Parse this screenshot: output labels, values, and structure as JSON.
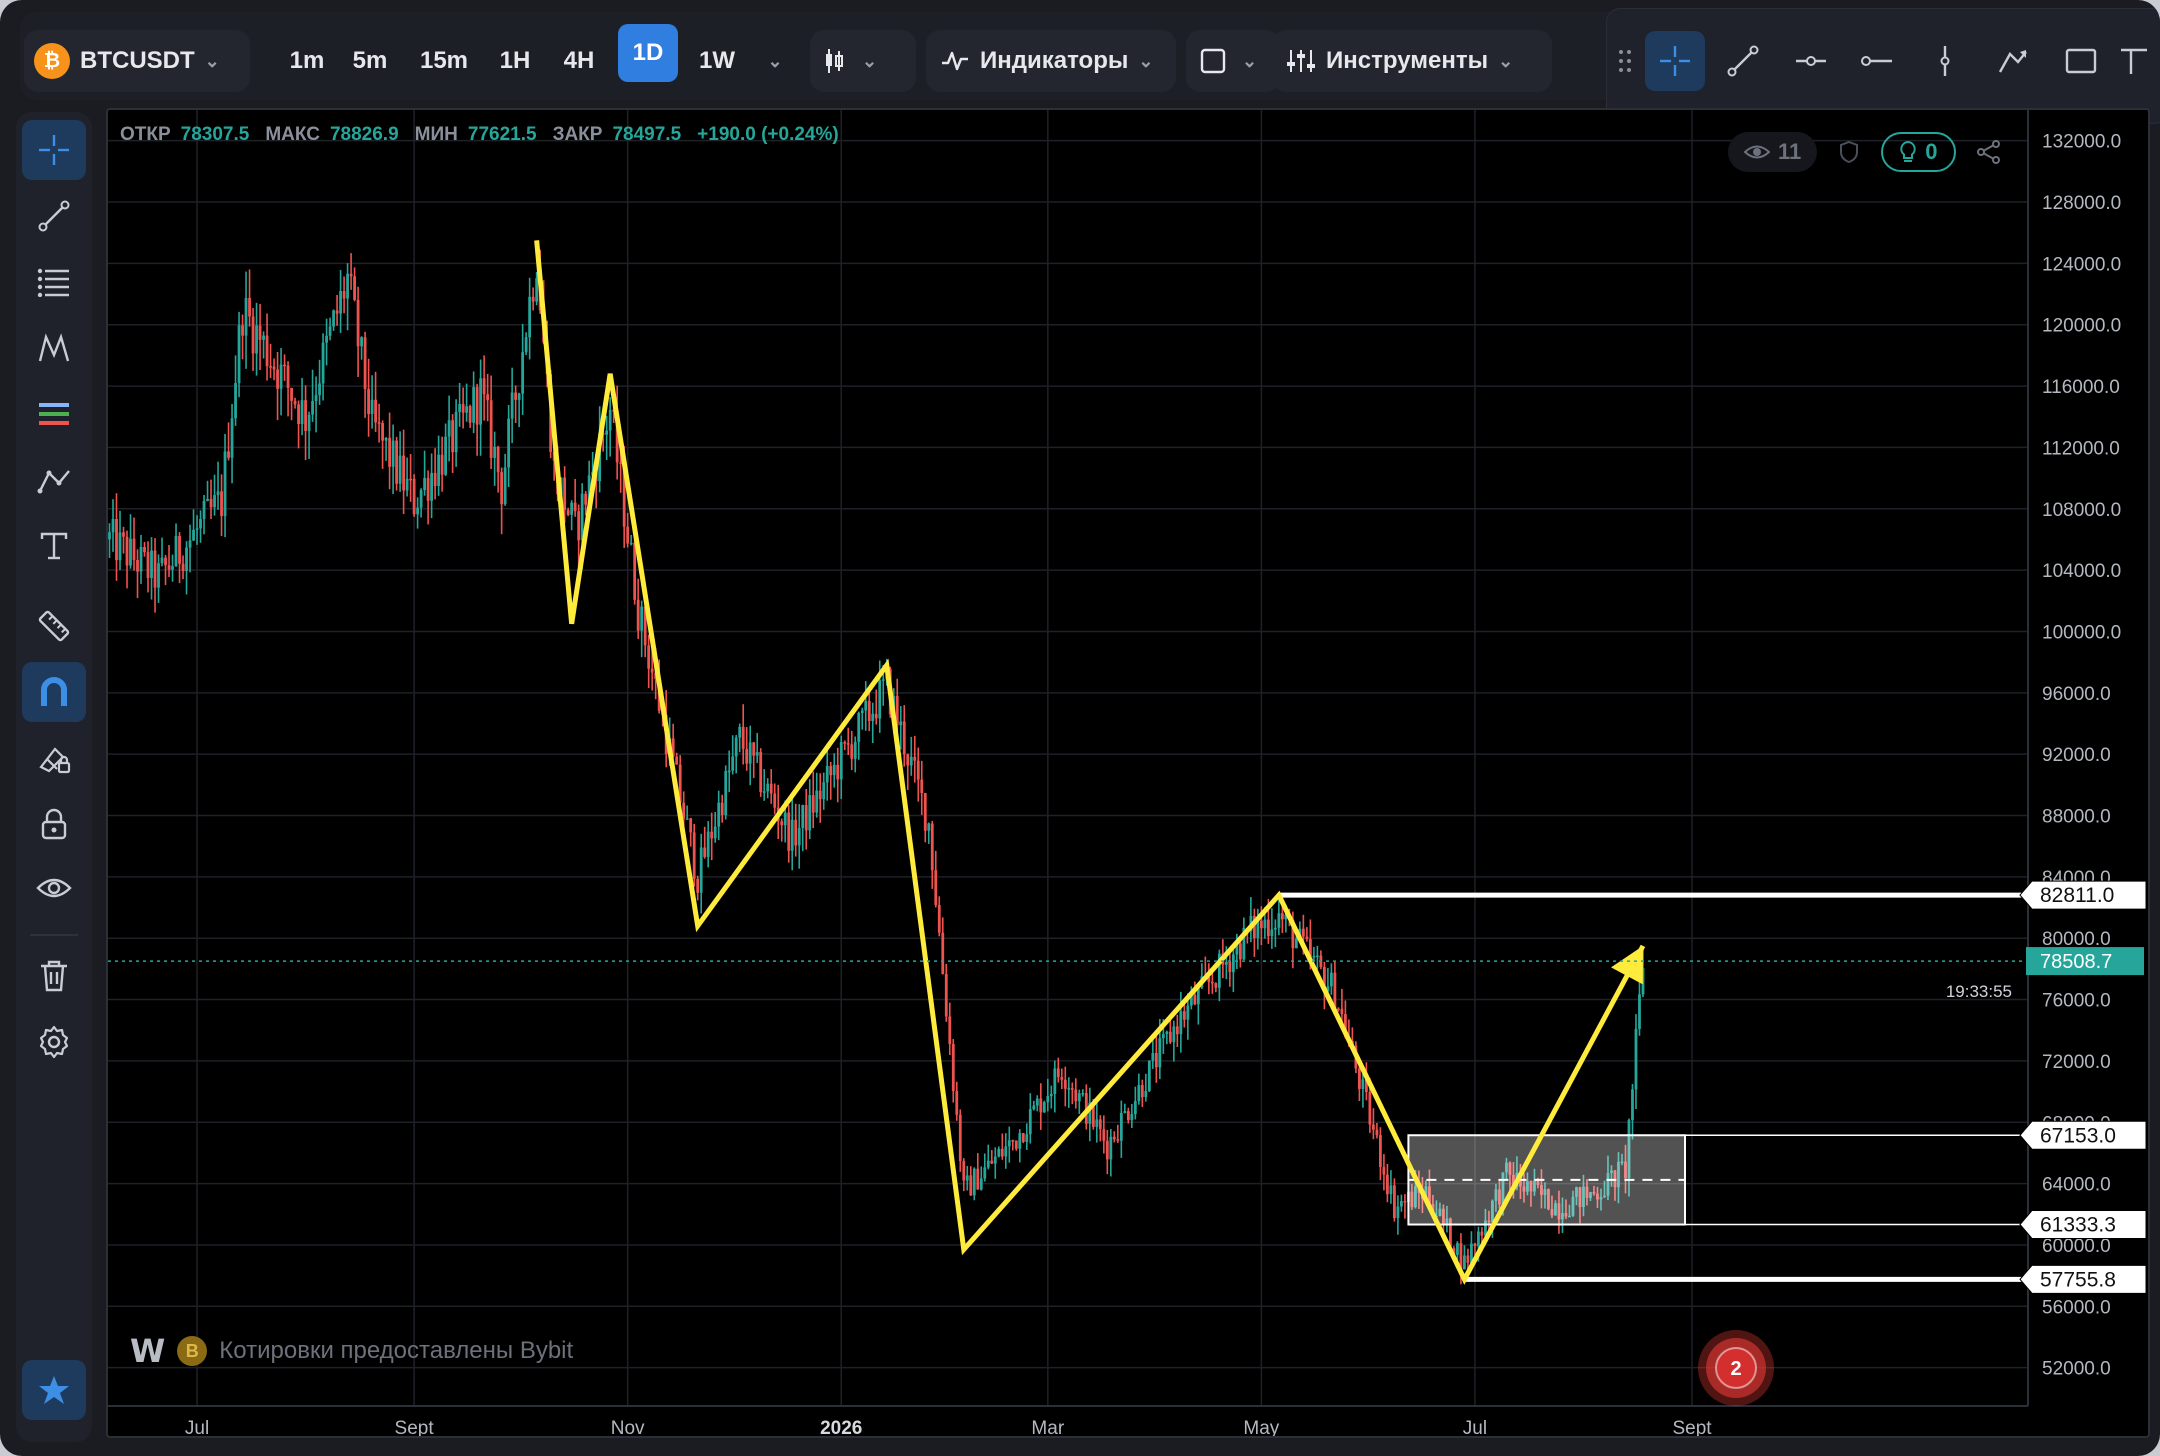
{
  "toolbar": {
    "symbol": "BTCUSDT",
    "coin_glyph": "₿",
    "timeframes": [
      "1m",
      "5m",
      "15m",
      "1H",
      "4H",
      "1D",
      "1W"
    ],
    "active_timeframe": "1D",
    "indicators_label": "Индикаторы",
    "tools_label": "Инструменты"
  },
  "ohlc": {
    "open_label": "ОТКР",
    "open": "78307.5",
    "high_label": "МАКС",
    "high": "78826.9",
    "low_label": "МИН",
    "low": "77621.5",
    "close_label": "ЗАКР",
    "close": "78497.5",
    "change": "+190.0 (+0.24%)"
  },
  "badges": {
    "views": "11",
    "ideas": "0"
  },
  "attribution": {
    "logo": "W",
    "coin_glyph": "B",
    "text": "Котировки предоставлены Bybit"
  },
  "alert_count": "2",
  "colors": {
    "up": "#26a69a",
    "down": "#ef5350",
    "drawing": "#ffeb3b",
    "accent": "#2f7ee0",
    "price_label": "#26a69a"
  },
  "left_tools": [
    "crosshair-icon",
    "trendline-icon",
    "fib-icon",
    "pattern-icon",
    "gann-icon",
    "path-icon",
    "text-icon",
    "ruler-icon",
    "magnet-icon",
    "brush-lock-icon",
    "lock-icon",
    "eye-icon",
    "trash-icon",
    "settings-icon",
    "star-icon"
  ],
  "chart_data": {
    "type": "candlestick",
    "timeframe": "1D",
    "x_tick_labels": [
      "Jul",
      "Sept",
      "Nov",
      "2026",
      "Mar",
      "May",
      "Jul",
      "Sept"
    ],
    "y_tick_labels": [
      "132000.0",
      "128000.0",
      "124000.0",
      "120000.0",
      "116000.0",
      "112000.0",
      "108000.0",
      "104000.0",
      "100000.0",
      "96000.0",
      "92000.0",
      "88000.0",
      "84000.0",
      "80000.0",
      "76000.0",
      "72000.0",
      "68000.0",
      "64000.0",
      "60000.0",
      "56000.0",
      "52000.0"
    ],
    "ylim": [
      49500,
      134000
    ],
    "last_price": "78508.7",
    "countdown": "19:33:55",
    "anchors": [
      {
        "date": "2025-06-06",
        "price": 106000
      },
      {
        "date": "2025-06-20",
        "price": 103500
      },
      {
        "date": "2025-07-08",
        "price": 108500
      },
      {
        "date": "2025-07-14",
        "price": 121000
      },
      {
        "date": "2025-08-01",
        "price": 114000
      },
      {
        "date": "2025-08-13",
        "price": 123000
      },
      {
        "date": "2025-08-20",
        "price": 113500
      },
      {
        "date": "2025-09-01",
        "price": 108500
      },
      {
        "date": "2025-09-20",
        "price": 115500
      },
      {
        "date": "2025-09-26",
        "price": 109500
      },
      {
        "date": "2025-10-06",
        "price": 124500
      },
      {
        "date": "2025-10-11",
        "price": 110500
      },
      {
        "date": "2025-10-17",
        "price": 106500
      },
      {
        "date": "2025-10-27",
        "price": 114500
      },
      {
        "date": "2025-11-04",
        "price": 101500
      },
      {
        "date": "2025-11-21",
        "price": 84000
      },
      {
        "date": "2025-12-03",
        "price": 93000
      },
      {
        "date": "2025-12-18",
        "price": 86500
      },
      {
        "date": "2026-01-14",
        "price": 96500
      },
      {
        "date": "2026-01-26",
        "price": 87500
      },
      {
        "date": "2026-02-05",
        "price": 63500
      },
      {
        "date": "2026-02-20",
        "price": 67000
      },
      {
        "date": "2026-03-05",
        "price": 71500
      },
      {
        "date": "2026-03-18",
        "price": 66500
      },
      {
        "date": "2026-04-07",
        "price": 74500
      },
      {
        "date": "2026-04-28",
        "price": 80500
      },
      {
        "date": "2026-05-06",
        "price": 81500
      },
      {
        "date": "2026-05-22",
        "price": 76500
      },
      {
        "date": "2026-06-08",
        "price": 62500
      },
      {
        "date": "2026-06-17",
        "price": 63500
      },
      {
        "date": "2026-06-28",
        "price": 58800
      },
      {
        "date": "2026-07-10",
        "price": 64500
      },
      {
        "date": "2026-07-25",
        "price": 62500
      },
      {
        "date": "2026-08-05",
        "price": 63500
      },
      {
        "date": "2026-08-13",
        "price": 65000
      },
      {
        "date": "2026-08-18",
        "price": 78500
      }
    ],
    "zigzag": [
      {
        "date": "2025-10-06",
        "price": 125500
      },
      {
        "date": "2025-10-16",
        "price": 100500
      },
      {
        "date": "2025-10-27",
        "price": 116800
      },
      {
        "date": "2025-11-21",
        "price": 80800
      },
      {
        "date": "2026-01-14",
        "price": 97800
      },
      {
        "date": "2026-02-05",
        "price": 59700
      },
      {
        "date": "2026-05-06",
        "price": 82811
      },
      {
        "date": "2026-06-28",
        "price": 57755
      },
      {
        "date": "2026-08-18",
        "price": 79500
      }
    ],
    "levels": [
      {
        "price": "82811.0",
        "from": "2026-05-06"
      },
      {
        "price": "57755.8",
        "from": "2026-06-28"
      }
    ],
    "range_box": {
      "top": "67153.0",
      "bottom": "61333.3",
      "from": "2026-06-12",
      "to": "2026-08-30"
    }
  }
}
